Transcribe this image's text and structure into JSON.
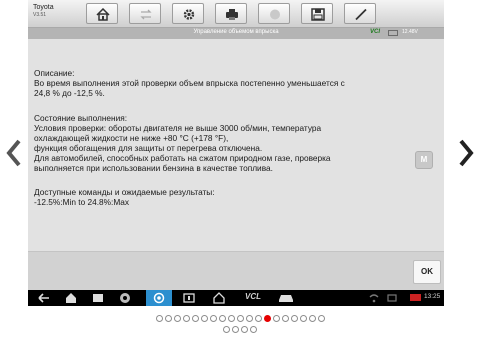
{
  "vehicle": {
    "make": "Toyota",
    "version": "V3.51"
  },
  "toolbar": {
    "buttons": [
      "home-icon",
      "vehicle-swap-icon",
      "settings-icon",
      "print-icon",
      "help-icon",
      "save-icon",
      "pen-icon"
    ]
  },
  "titlebar": {
    "title": "Управление объемом впрыска",
    "vci": "VCI",
    "battery": "12.48V"
  },
  "content": {
    "description_heading": "Описание:",
    "description_lines": [
      "Во время выполнения этой проверки объем впрыска постепенно уменьшается с",
      "24,8 % до -12,5 %."
    ],
    "status_heading": "Состояние выполнения:",
    "status_lines": [
      "Условия проверки: обороты двигателя не выше 3000 об/мин, температура",
      "охлаждающей жидкости не ниже +80 °С (+178 °F),",
      "функция обогащения для защиты от перегрева отключена.",
      "Для автомобилей, способных работать на сжатом природном газе, проверка",
      "выполняется при использовании бензина в качестве топлива."
    ],
    "commands_heading": "Доступные команды и ожидаемые результаты:",
    "commands_lines": [
      "-12.5%:Min to 24.8%:Max"
    ]
  },
  "side_button": "M",
  "footer": {
    "ok_label": "OK"
  },
  "navbar": {
    "vcl_label": "VCL",
    "time": "13:25"
  },
  "pager": {
    "row1_count": 19,
    "row2_count": 4,
    "active_index": 12
  },
  "colors": {
    "accent_blue": "#2c8fcf",
    "vci_green": "#1e7a1e",
    "active_dot": "#e60000"
  }
}
